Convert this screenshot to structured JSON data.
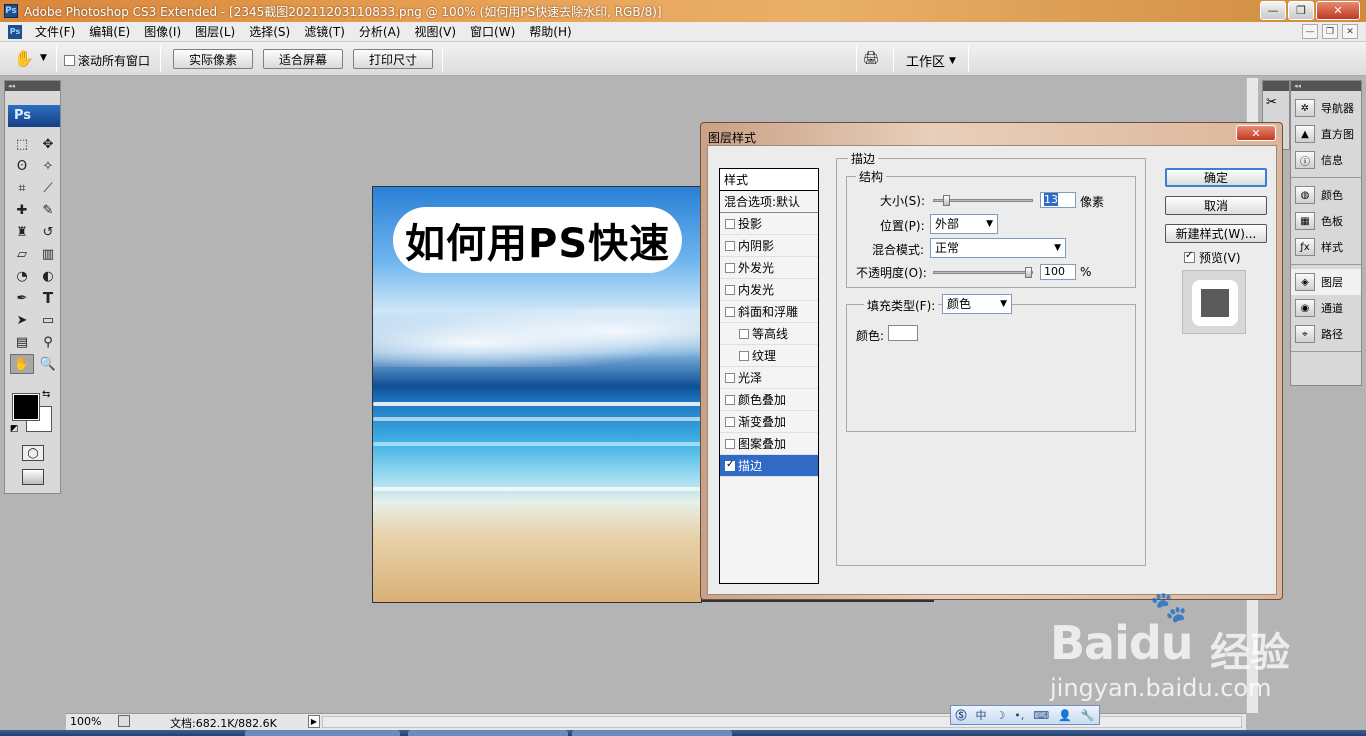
{
  "titlebar": {
    "title": "Adobe Photoshop CS3 Extended - [2345截图20211203110833.png @ 100% (如何用PS快速去除水印, RGB/8)]",
    "app_icon": "Ps"
  },
  "menubar": {
    "items": [
      "文件(F)",
      "编辑(E)",
      "图像(I)",
      "图层(L)",
      "选择(S)",
      "滤镜(T)",
      "分析(A)",
      "视图(V)",
      "窗口(W)",
      "帮助(H)"
    ]
  },
  "optionsbar": {
    "scroll_all_label": "滚动所有窗口",
    "actual_pixels": "实际像素",
    "fit_screen": "适合屏幕",
    "print_size": "打印尺寸",
    "workspace": "工作区"
  },
  "toolbox": {
    "logo": "Ps",
    "tools": [
      "marquee-icon",
      "move-icon",
      "lasso-icon",
      "magic-wand-icon",
      "crop-icon",
      "slice-icon",
      "healing-brush-icon",
      "brush-icon",
      "clone-stamp-icon",
      "history-brush-icon",
      "eraser-icon",
      "gradient-icon",
      "blur-icon",
      "dodge-icon",
      "pen-icon",
      "type-icon",
      "path-selection-icon",
      "rectangle-icon",
      "notes-icon",
      "eyedropper-icon",
      "hand-icon",
      "zoom-icon"
    ],
    "foreground_color": "#000000",
    "background_color": "#ffffff"
  },
  "canvas": {
    "text": "如何用PS快速"
  },
  "statusbar": {
    "zoom": "100%",
    "doc": "文档:682.1K/882.6K"
  },
  "dock": {
    "group1": [
      "导航器",
      "直方图",
      "信息"
    ],
    "group2": [
      "颜色",
      "色板",
      "样式"
    ],
    "group3": [
      "图层",
      "通道",
      "路径"
    ]
  },
  "dialog": {
    "title": "图层样式",
    "styles_header": "样式",
    "blend_default": "混合选项:默认",
    "effects": [
      {
        "label": "投影",
        "checked": false,
        "sub": false
      },
      {
        "label": "内阴影",
        "checked": false,
        "sub": false
      },
      {
        "label": "外发光",
        "checked": false,
        "sub": false
      },
      {
        "label": "内发光",
        "checked": false,
        "sub": false
      },
      {
        "label": "斜面和浮雕",
        "checked": false,
        "sub": false
      },
      {
        "label": "等高线",
        "checked": false,
        "sub": true
      },
      {
        "label": "纹理",
        "checked": false,
        "sub": true
      },
      {
        "label": "光泽",
        "checked": false,
        "sub": false
      },
      {
        "label": "颜色叠加",
        "checked": false,
        "sub": false
      },
      {
        "label": "渐变叠加",
        "checked": false,
        "sub": false
      },
      {
        "label": "图案叠加",
        "checked": false,
        "sub": false
      },
      {
        "label": "描边",
        "checked": true,
        "sub": false
      }
    ],
    "stroke": {
      "section": "描边",
      "structure": "结构",
      "size_label": "大小(S):",
      "size_value": "13",
      "size_unit": "像素",
      "size_level": 0.1,
      "position_label": "位置(P):",
      "position_value": "外部",
      "blend_label": "混合模式:",
      "blend_value": "正常",
      "opacity_label": "不透明度(O):",
      "opacity_value": "100",
      "opacity_unit": "%",
      "opacity_level": 1.0,
      "fill_type_label": "填充类型(F):",
      "fill_type_value": "颜色",
      "color_label": "颜色:",
      "color_value": "#ffffff"
    },
    "buttons": {
      "ok": "确定",
      "cancel": "取消",
      "new_style": "新建样式(W)...",
      "preview": "预览(V)"
    }
  },
  "imebar": {
    "items": [
      "中",
      "☽",
      "•,",
      "⌨",
      "👤",
      "🔧"
    ]
  },
  "watermark": {
    "brand": "Bai",
    "brand2": "du",
    "cn": "经验",
    "url": "jingyan.baidu.com"
  }
}
